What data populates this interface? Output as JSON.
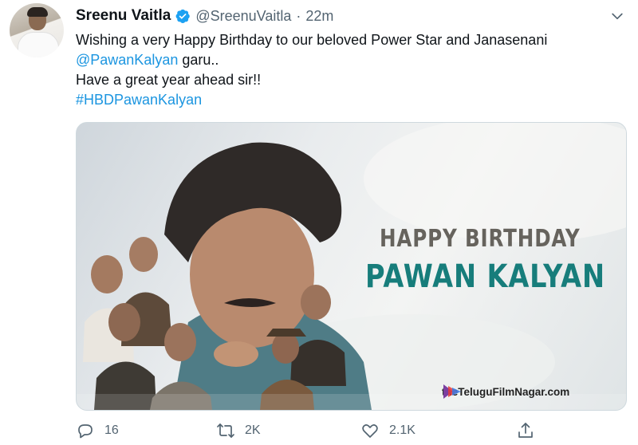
{
  "tweet": {
    "author_name": "Sreenu Vaitla",
    "handle": "@SreenuVaitla",
    "separator": "·",
    "time": "22m",
    "text_1": "Wishing a very Happy Birthday to our beloved Power Star and Janasenani",
    "mention": "@PawanKalyan",
    "text_2": " garu..",
    "text_3": "Have a great year ahead sir!!",
    "hashtag": "#HBDPawanKalyan"
  },
  "media": {
    "headline_1": "HAPPY BIRTHDAY",
    "headline_2": "PAWAN KALYAN",
    "watermark": "theTeluguFilmNagar.com"
  },
  "actions": {
    "reply_count": "16",
    "retweet_count": "2K",
    "like_count": "2.1K"
  },
  "colors": {
    "link": "#1b95e0",
    "verified": "#1da1f2",
    "secondary_text": "#536471",
    "headline_2": "#177d7b"
  },
  "icons": [
    "verified-badge-icon",
    "chevron-down-icon",
    "reply-icon",
    "retweet-icon",
    "like-icon",
    "share-icon"
  ]
}
